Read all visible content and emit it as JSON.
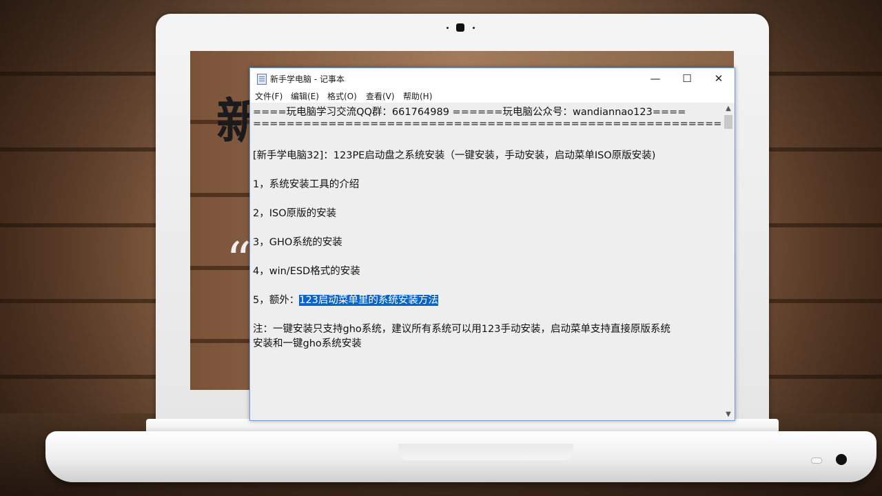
{
  "window": {
    "title": "新手学电脑 - 记事本",
    "controls": {
      "minimize": "—",
      "maximize": "☐",
      "close": "✕"
    }
  },
  "menu": [
    {
      "label": "文件(F)"
    },
    {
      "label": "编辑(E)"
    },
    {
      "label": "格式(O)"
    },
    {
      "label": "查看(V)"
    },
    {
      "label": "帮助(H)"
    }
  ],
  "background": {
    "big_char": "新",
    "quote_mark": "“"
  },
  "document": {
    "header_line": "====玩电脑学习交流QQ群：661764989 ======玩电脑公众号：wandiannao123====",
    "separator_line": "=========================================================",
    "title_line": "[新手学电脑32]：123PE启动盘之系统安装（一键安装，手动安装，启动菜单ISO原版安装)",
    "items": [
      "1，系统安装工具的介绍",
      "2，ISO原版的安装",
      "3，GHO系统的安装",
      "4，win/ESD格式的安装"
    ],
    "item5_prefix": "5，额外：",
    "item5_selected": "123启动菜单里的系统安装方法",
    "note_line1": "注：一键安装只支持gho系统，建议所有系统可以用123手动安装，启动菜单支持直接原版系统",
    "note_line2": "安装和一键gho系统安装"
  },
  "colors": {
    "selection": "#0a64c8",
    "window_border": "#6aa0d8"
  }
}
